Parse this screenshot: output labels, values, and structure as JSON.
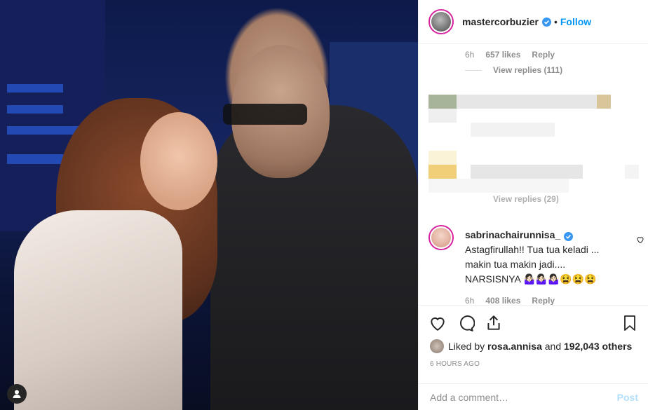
{
  "post": {
    "username": "mastercorbuzier",
    "separator": "•",
    "follow_label": "Follow"
  },
  "reply_meta_1": {
    "time": "6h",
    "likes": "657 likes",
    "reply": "Reply"
  },
  "view_replies_1": "View replies (111)",
  "view_replies_2": "View replies (29)",
  "comment": {
    "username": "sabrinachairunnisa_",
    "line1": "Astagfirullah!! Tua tua keladi ...",
    "line2": "makin tua makin jadi....",
    "line3": "NARSISNYA 🤷🏻‍♀️🤷🏻‍♀️🤷🏻‍♀️😫😫😫",
    "time": "6h",
    "likes": "408 likes",
    "reply": "Reply"
  },
  "actions": {
    "liked_by_prefix": "Liked by",
    "liked_by_user": "rosa.annisa",
    "and": "and",
    "others": "192,043 others",
    "time_ago": "6 HOURS AGO"
  },
  "add_comment": {
    "placeholder": "Add a comment…",
    "post_label": "Post"
  },
  "colors": {
    "accent": "#0095f6",
    "post_disabled": "#b2dffc",
    "muted": "#8e8e8e",
    "ring": "#d6249f"
  },
  "icons": [
    "verified-badge-icon",
    "heart-icon",
    "comment-icon",
    "share-icon",
    "bookmark-icon",
    "user-tag-icon"
  ]
}
